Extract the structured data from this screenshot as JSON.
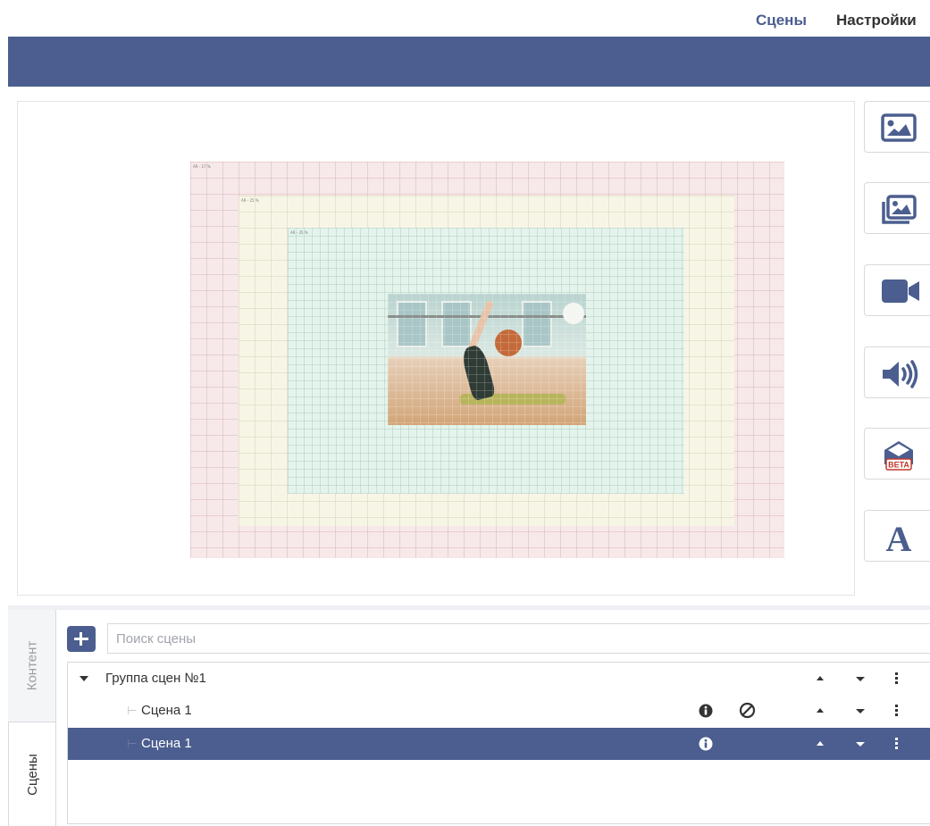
{
  "nav": {
    "scenes_label": "Сцены",
    "settings_label": "Настройки"
  },
  "stage": {
    "zones": [
      "AR - 17 %",
      "AR - 25 %",
      "AR - 35 %"
    ]
  },
  "toolbar": {
    "tools": [
      "image-icon",
      "gallery-icon",
      "video-icon",
      "audio-icon",
      "beta-module-icon",
      "text-icon"
    ],
    "beta_badge": "BETA",
    "text_tool_glyph": "A"
  },
  "side_tabs": {
    "content_label": "Контент",
    "scenes_label": "Сцены"
  },
  "search": {
    "placeholder": "Поиск сцены"
  },
  "tree": {
    "group_label": "Группа сцен №1",
    "scenes": [
      {
        "label": "Сцена 1",
        "selected": false
      },
      {
        "label": "Сцена 1",
        "selected": true
      }
    ]
  },
  "colors": {
    "accent": "#4b5e8f",
    "nav_active": "#4a5d8f"
  }
}
